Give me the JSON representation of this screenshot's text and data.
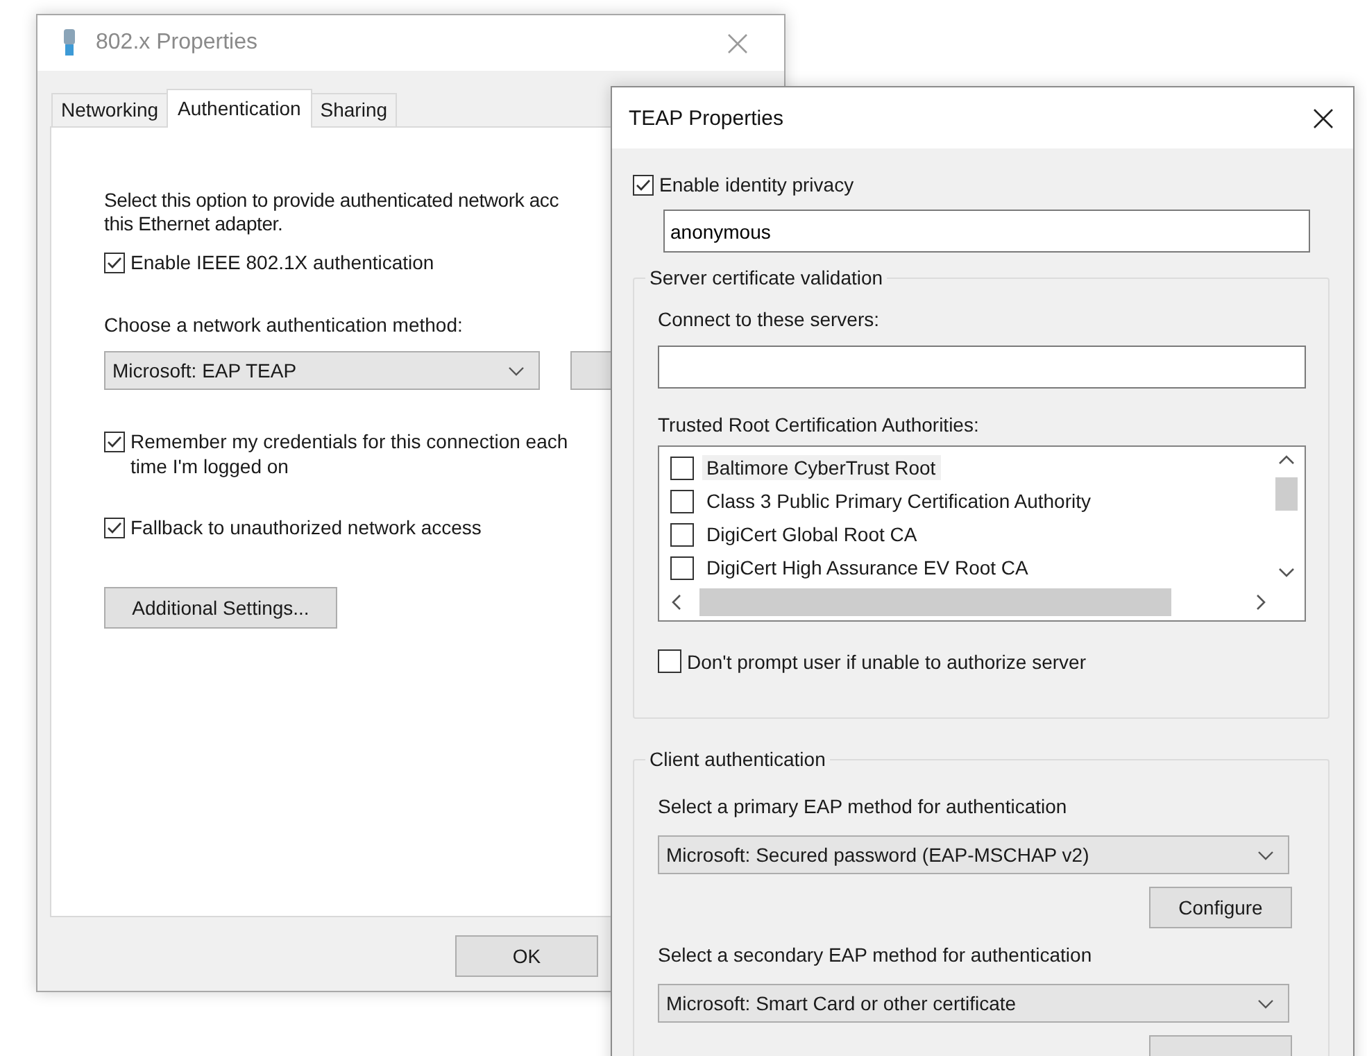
{
  "main_window": {
    "title": "802.x Properties",
    "tabs": [
      {
        "label": "Networking",
        "selected": false
      },
      {
        "label": "Authentication",
        "selected": true
      },
      {
        "label": "Sharing",
        "selected": false
      }
    ],
    "description": [
      "Select this option to provide authenticated network acc",
      "this Ethernet adapter."
    ],
    "enable_8021x": {
      "label": "Enable IEEE 802.1X authentication",
      "checked": true
    },
    "method_label": "Choose a network authentication method:",
    "method_select": "Microsoft: EAP TEAP",
    "remember": {
      "label": "Remember my credentials for this connection each time I'm logged on",
      "checked": true
    },
    "fallback": {
      "label": "Fallback to unauthorized network access",
      "checked": true
    },
    "additional_button": "Additional Settings...",
    "ok_button": "OK"
  },
  "teap_window": {
    "title": "TEAP Properties",
    "identity_privacy": {
      "label": "Enable identity privacy",
      "checked": true
    },
    "identity_value": "anonymous",
    "server_group": {
      "legend": "Server certificate validation",
      "connect_label": "Connect to these servers:",
      "trusted_label": "Trusted Root Certification Authorities:",
      "authorities": [
        {
          "name": "Baltimore CyberTrust Root",
          "checked": false,
          "selected": true
        },
        {
          "name": "Class 3 Public Primary Certification Authority",
          "checked": false,
          "selected": false
        },
        {
          "name": "DigiCert Global Root CA",
          "checked": false,
          "selected": false
        },
        {
          "name": "DigiCert High Assurance EV Root CA",
          "checked": false,
          "selected": false
        }
      ],
      "dont_prompt": {
        "label": "Don't prompt user if unable to authorize server",
        "checked": false
      }
    },
    "client_group": {
      "legend": "Client authentication",
      "primary_label": "Select a primary EAP method for authentication",
      "primary_select": "Microsoft: Secured password (EAP-MSCHAP v2)",
      "configure_button": "Configure",
      "secondary_label": "Select a secondary EAP method for authentication",
      "secondary_select": "Microsoft: Smart Card or other certificate"
    }
  }
}
